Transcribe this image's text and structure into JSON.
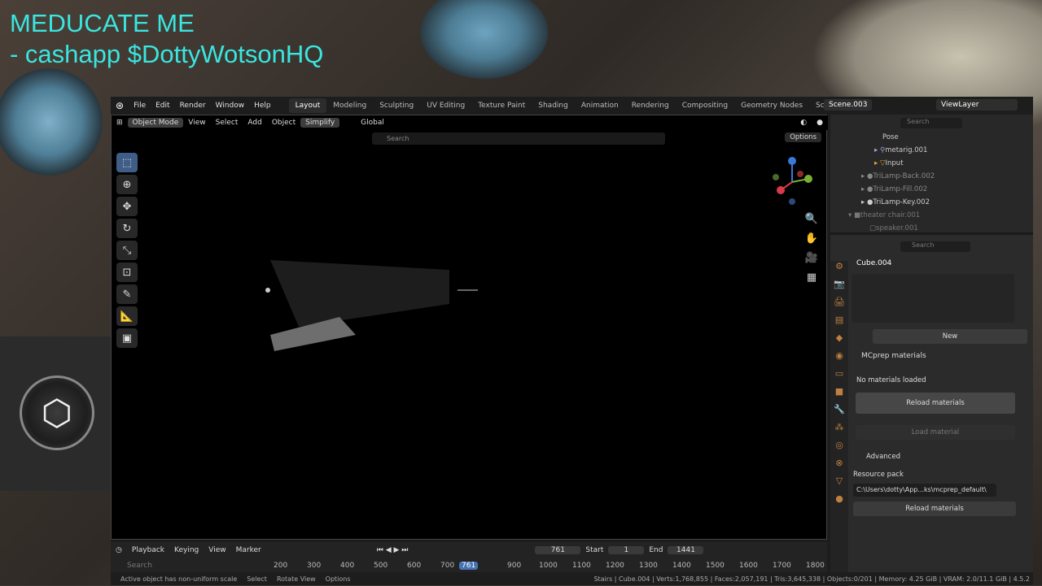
{
  "overlay": {
    "line1": "MEDUCATE ME",
    "line2": "- cashapp $DottyWotsonHQ"
  },
  "menu": [
    "File",
    "Edit",
    "Render",
    "Window",
    "Help"
  ],
  "workspaces": [
    "Layout",
    "Modeling",
    "Sculpting",
    "UV Editing",
    "Texture Paint",
    "Shading",
    "Animation",
    "Rendering",
    "Compositing",
    "Geometry Nodes",
    "Scripting"
  ],
  "scene": "Scene.003",
  "view_layer": "ViewLayer",
  "viewport_header": {
    "mode": "Object Mode",
    "view": "View",
    "select": "Select",
    "add": "Add",
    "object": "Object",
    "simplify": "Simplify",
    "orientation": "Global",
    "options": "Options",
    "search_placeholder": "Search"
  },
  "outliner": {
    "search_placeholder": "Search",
    "rows": [
      "Pose",
      "metarig.001",
      "Input",
      "TriLamp-Back.002",
      "TriLamp-Fill.002",
      "TriLamp-Key.002",
      "theater chair.001",
      "speaker.001"
    ]
  },
  "props": {
    "search_placeholder": "Search",
    "object_name": "Cube.004",
    "new_label": "New",
    "panel_title": "MCprep materials",
    "no_materials": "No materials loaded",
    "reload_materials": "Reload materials",
    "load_material": "Load material",
    "advanced": "Advanced",
    "resource_pack": "Resource pack",
    "resource_path": "C:\\Users\\dotty\\App...ks\\mcprep_default\\",
    "reload_materials_2": "Reload materials"
  },
  "timeline": {
    "playback": "Playback",
    "keying": "Keying",
    "view": "View",
    "marker": "Marker",
    "current_frame": "761",
    "start_label": "Start",
    "start": "1",
    "end_label": "End",
    "end": "1441",
    "search_placeholder": "Search",
    "ticks": [
      "200",
      "300",
      "400",
      "500",
      "600",
      "700",
      "761",
      "900",
      "1000",
      "1100",
      "1200",
      "1300",
      "1400",
      "1500",
      "1600",
      "1700",
      "1800"
    ]
  },
  "status": {
    "warning": "Active object has non-uniform scale",
    "select": "Select",
    "rotate": "Rotate View",
    "options": "Options",
    "stats": "Stairs | Cube.004 | Verts:1,768,855 | Faces:2,057,191 | Tris:3,645,338 | Objects:0/201 | Memory: 4.25 GiB | VRAM: 2.0/11.1 GiB | 4.5.2"
  }
}
